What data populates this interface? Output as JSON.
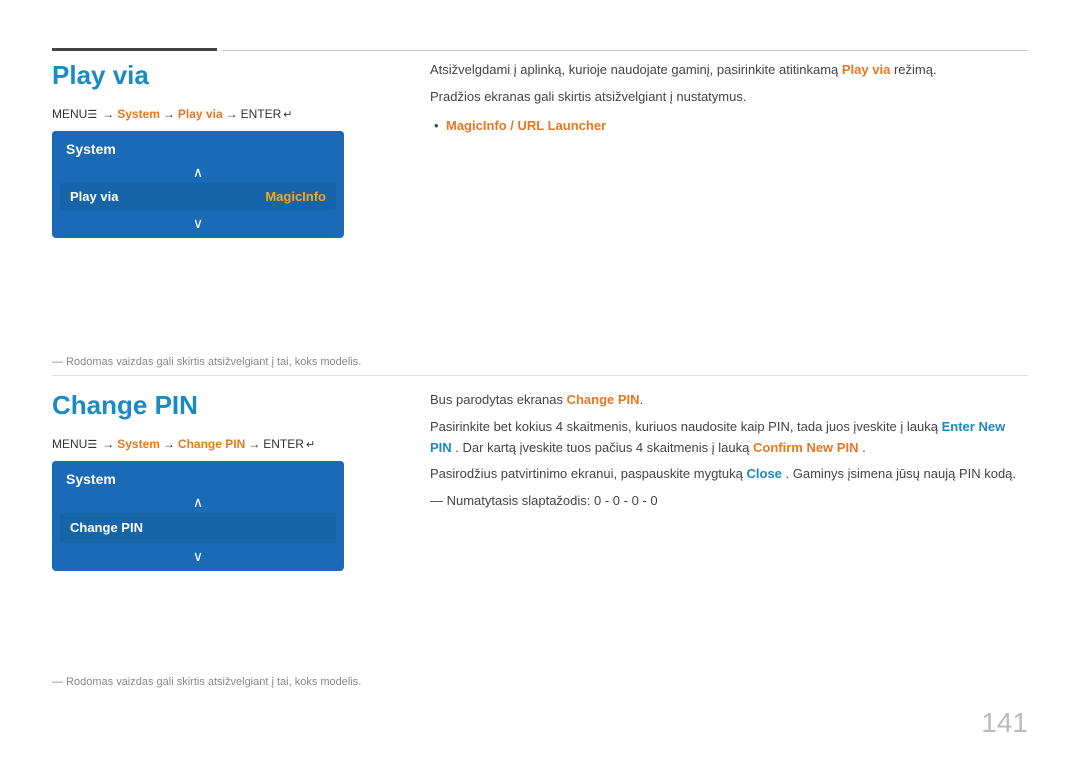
{
  "page": {
    "number": "141"
  },
  "top_line": {
    "visible": true
  },
  "play_via_section": {
    "title": "Play via",
    "menu_path": {
      "menu_label": "MENU",
      "menu_icon": "☰",
      "system": "System",
      "play_via": "Play via",
      "enter": "ENTER",
      "enter_icon": "↵"
    },
    "system_box": {
      "header": "System",
      "item_label": "Play via",
      "item_value": "MagicInfo"
    },
    "note": "— Rodomas vaizdas gali skirtis atsižvelgiant į tai, koks modelis.",
    "desc_line1": "Atsižvelgdami į aplinką, kurioje naudojate gaminį, pasirinkite atitinkamą",
    "desc_play_via": "Play via",
    "desc_line1_end": "režimą.",
    "desc_line2": "Pradžios ekranas gali skirtis atsižvelgiant į nustatymus.",
    "desc_list_item": "MagicInfo / URL Launcher"
  },
  "change_pin_section": {
    "title": "Change PIN",
    "menu_path": {
      "menu_label": "MENU",
      "menu_icon": "☰",
      "system": "System",
      "change_pin": "Change PIN",
      "enter": "ENTER",
      "enter_icon": "↵"
    },
    "system_box": {
      "header": "System",
      "item_label": "Change PIN"
    },
    "note": "— Rodomas vaizdas gali skirtis atsižvelgiant į tai, koks modelis.",
    "desc_line1": "Bus parodytas ekranas",
    "desc_change_pin": "Change PIN",
    "desc_line2_before": "Pasirinkite bet kokius 4 skaitmenis, kuriuos naudosite kaip PIN, tada juos įveskite į lauką",
    "desc_enter_new_pin": "Enter New PIN",
    "desc_line2_middle": ". Dar kartą įveskite tuos pačius 4 skaitmenis į lauką",
    "desc_confirm_new_pin": "Confirm New PIN",
    "desc_line2_end": ".",
    "desc_line3_before": "Pasirodžius patvirtinimo ekranui, paspauskite mygtuką",
    "desc_close": "Close",
    "desc_line3_end": ". Gaminys įsimena jūsų naują PIN kodą.",
    "desc_default": "— Numatytasis slaptažodis: 0 - 0 - 0 - 0"
  }
}
